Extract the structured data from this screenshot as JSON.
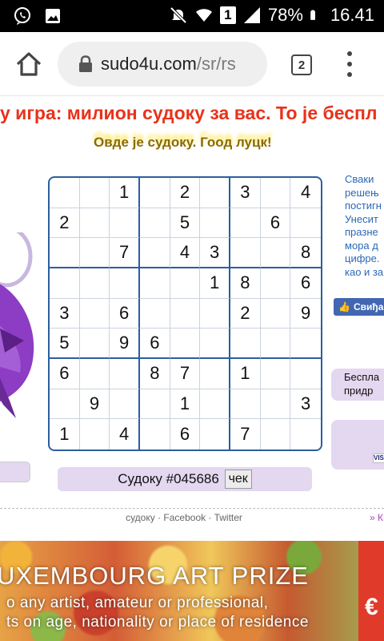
{
  "status_bar": {
    "battery": "78%",
    "time": "16.41",
    "sim": "1"
  },
  "browser": {
    "url_host": "sudo4u.com",
    "url_path": "/sr/rs",
    "tab_count": "2"
  },
  "page": {
    "headline": "у игра: милион судоку за вас. То је беспл",
    "subline": "Овде је судоку. Гоод луцк!",
    "grid": [
      [
        "",
        "",
        "1",
        "",
        "2",
        "",
        "3",
        "",
        "4"
      ],
      [
        "2",
        "",
        "",
        "",
        "5",
        "",
        "",
        "6",
        ""
      ],
      [
        "",
        "",
        "7",
        "",
        "4",
        "3",
        "",
        "",
        "8"
      ],
      [
        "",
        "",
        "",
        "",
        "",
        "1",
        "8",
        "",
        "6"
      ],
      [
        "3",
        "",
        "6",
        "",
        "",
        "",
        "2",
        "",
        "9"
      ],
      [
        "5",
        "",
        "9",
        "6",
        "",
        "",
        "",
        "",
        ""
      ],
      [
        "6",
        "",
        "",
        "8",
        "7",
        "",
        "1",
        "",
        ""
      ],
      [
        "",
        "9",
        "",
        "",
        "1",
        "",
        "",
        "",
        "3"
      ],
      [
        "1",
        "",
        "4",
        "",
        "6",
        "",
        "7",
        "",
        ""
      ]
    ],
    "sudoku_label": "Судоку #045686",
    "check_label": "чек",
    "side_text": [
      "Сваки",
      "решењ",
      "постигн",
      "Унесит",
      "празне",
      "мора д",
      "цифре.",
      "као и за"
    ],
    "fb_like": "Свиђа",
    "side_box1": [
      "Беспла",
      "придр"
    ],
    "visa": "VISA",
    "footer_links": [
      "судоку",
      "Facebook",
      "Twitter"
    ],
    "footer_more": "» К"
  },
  "banner": {
    "title": "UXEMBOURG ART PRIZE",
    "line1": "o any artist, amateur or professional,",
    "line2": "ts on age, nationality or place of residence",
    "euro": "€"
  }
}
